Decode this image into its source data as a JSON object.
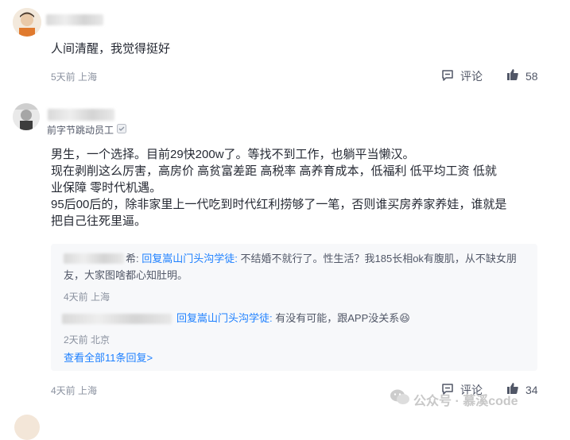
{
  "comment1": {
    "text": "人间清醒，我觉得挺好",
    "time_location": "5天前 上海",
    "comment_label": "评论",
    "like_count": "58"
  },
  "comment2": {
    "user_title": "前字节跳动员工",
    "text_lines": [
      "男生，一个选择。目前29快200w了。等找不到工作，也躺平当懒汉。",
      "现在剥削这么厉害，高房价 高贫富差距 高税率 高养育成本，低福利 低平均工资 低就",
      "业保障 零时代机遇。",
      "95后00后的，除非家里上一代吃到时代红利捞够了一笔，否则谁买房养家养娃，谁就是",
      "把自己往死里逼。"
    ],
    "time_location": "4天前 上海",
    "comment_label": "评论",
    "like_count": "34",
    "replies": [
      {
        "name_suffix": "希:",
        "reply_to": "回复嵩山门头沟学徒:",
        "text_line1": "不结婚不就行了。性生活？我185长相ok有腹肌，从不缺女朋",
        "text_line2": "友，大家图啥都心知肚明。",
        "time_location": "4天前 上海"
      },
      {
        "reply_to": "回复嵩山门头沟学徒:",
        "text": "有没有可能，跟APP没关系😆",
        "time_location": "2天前 北京"
      }
    ],
    "view_all": "查看全部11条回复>"
  },
  "watermark": "公众号 · 慕溪code"
}
